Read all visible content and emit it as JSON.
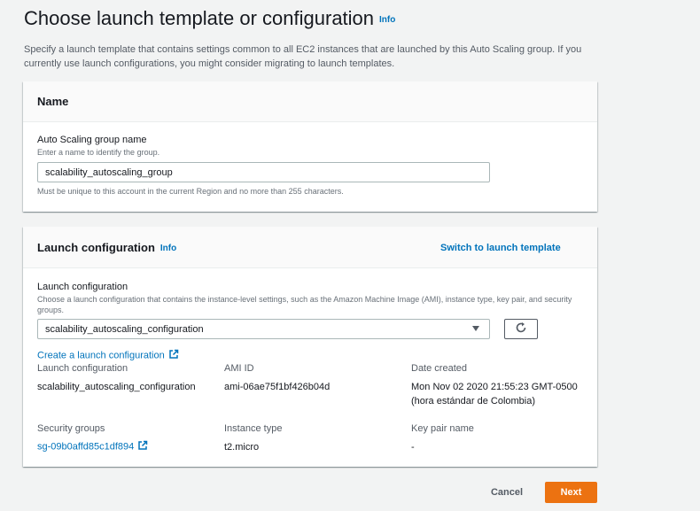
{
  "page": {
    "title": "Choose launch template or configuration",
    "info_label": "Info",
    "description": "Specify a launch template that contains settings common to all EC2 instances that are launched by this Auto Scaling group. If you currently use launch configurations, you might consider migrating to launch templates."
  },
  "name_section": {
    "title": "Name",
    "field_label": "Auto Scaling group name",
    "field_hint": "Enter a name to identify the group.",
    "field_value": "scalability_autoscaling_group",
    "field_constraint": "Must be unique to this account in the current Region and no more than 255 characters."
  },
  "launch_section": {
    "title": "Launch configuration",
    "info_label": "Info",
    "switch_link": "Switch to launch template",
    "field_label": "Launch configuration",
    "field_hint": "Choose a launch configuration that contains the instance-level settings, such as the Amazon Machine Image (AMI), instance type, key pair, and security groups.",
    "selected_value": "scalability_autoscaling_configuration",
    "create_link": "Create a launch configuration",
    "details": {
      "launch_configuration_label": "Launch configuration",
      "launch_configuration_value": "scalability_autoscaling_configuration",
      "ami_id_label": "AMI ID",
      "ami_id_value": "ami-06ae75f1bf426b04d",
      "date_created_label": "Date created",
      "date_created_value": "Mon Nov 02 2020 21:55:23 GMT-0500 (hora estándar de Colombia)",
      "security_groups_label": "Security groups",
      "security_groups_value": "sg-09b0affd85c1df894",
      "instance_type_label": "Instance type",
      "instance_type_value": "t2.micro",
      "key_pair_label": "Key pair name",
      "key_pair_value": "-"
    }
  },
  "footer": {
    "cancel_label": "Cancel",
    "next_label": "Next"
  },
  "colors": {
    "link": "#0073bb",
    "primary_button": "#ec7211",
    "background": "#f2f3f3"
  },
  "icons": [
    "info-link",
    "refresh-icon",
    "dropdown-caret-icon",
    "external-link-icon"
  ]
}
